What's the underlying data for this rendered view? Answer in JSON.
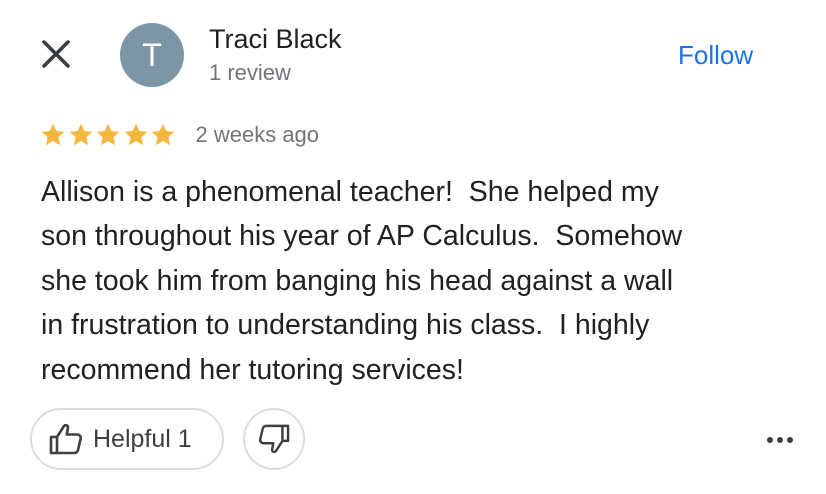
{
  "header": {
    "close_icon": "close-icon",
    "avatar": {
      "initial": "T",
      "background": "#7d96a6"
    },
    "reviewer_name": "Traci Black",
    "review_count": "1 review",
    "follow_label": "Follow",
    "follow_color": "#1a73e8"
  },
  "rating": {
    "stars": 5,
    "star_color": "#f4b83f",
    "date": "2 weeks ago"
  },
  "review": {
    "lines": [
      "Allison is a phenomenal teacher!  She helped my",
      "son throughout his year of AP Calculus.  Somehow",
      "she took him from banging his head against a wall",
      "in frustration to understanding his class.  I highly",
      "recommend her tutoring services!"
    ]
  },
  "actions": {
    "helpful_icon": "thumbs-up-icon",
    "helpful_label": "Helpful 1",
    "dislike_icon": "thumbs-down-icon",
    "more_icon": "more-horizontal-icon"
  }
}
